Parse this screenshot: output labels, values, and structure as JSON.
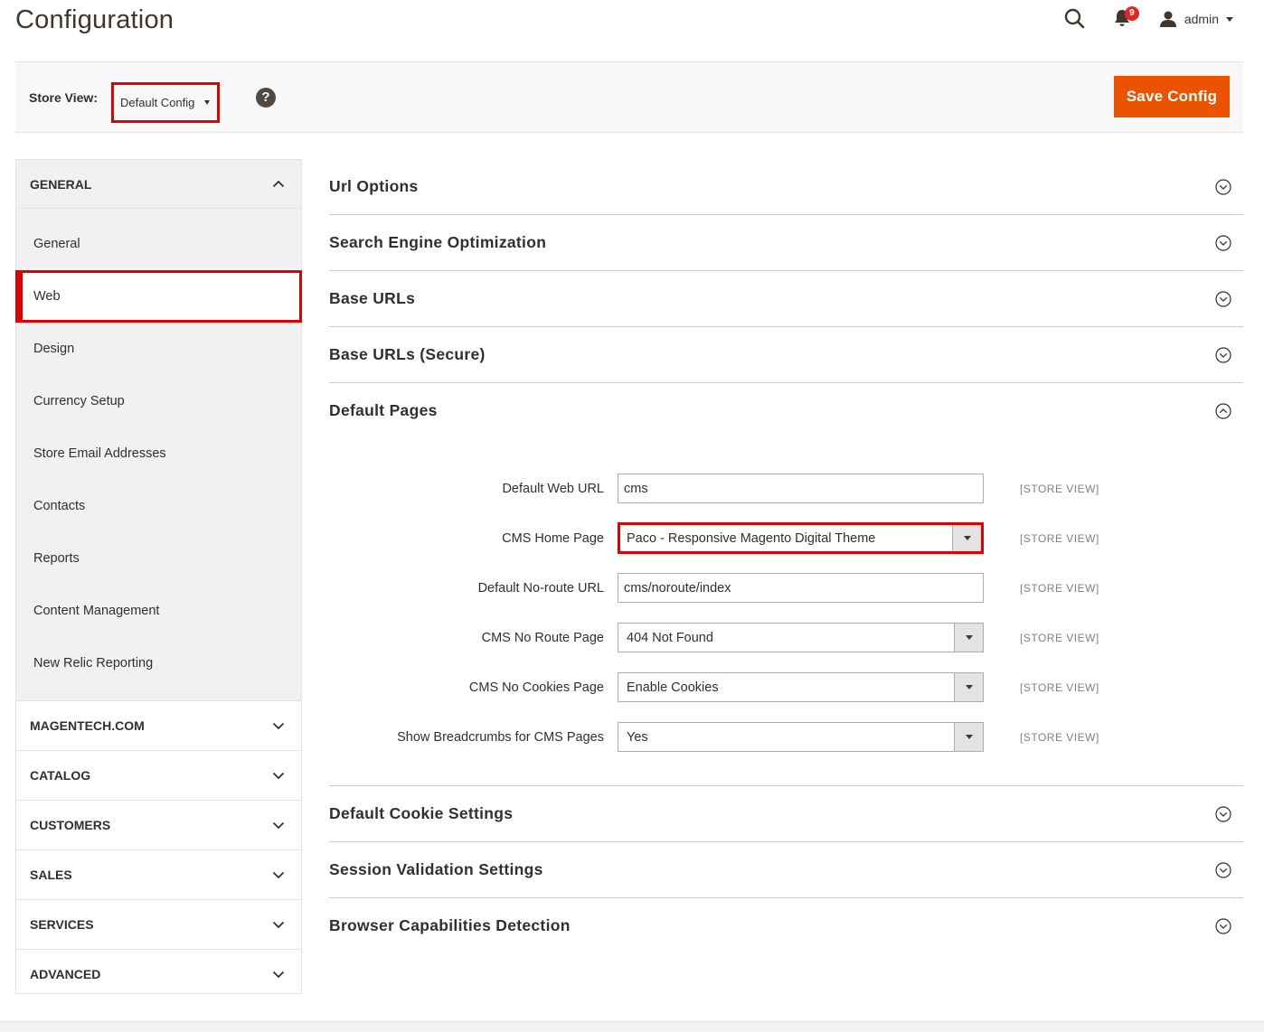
{
  "header": {
    "title": "Configuration",
    "notification_count": "9",
    "user_name": "admin",
    "icons": [
      "search-icon",
      "bell-icon",
      "user-icon"
    ]
  },
  "toolbar": {
    "store_view_label": "Store View:",
    "store_view_value": "Default Config",
    "help_glyph": "?",
    "save_label": "Save Config",
    "save_color": "#eb5202"
  },
  "sidebar": {
    "general": {
      "label": "GENERAL",
      "items": [
        {
          "label": "General"
        },
        {
          "label": "Web"
        },
        {
          "label": "Design"
        },
        {
          "label": "Currency Setup"
        },
        {
          "label": "Store Email Addresses"
        },
        {
          "label": "Contacts"
        },
        {
          "label": "Reports"
        },
        {
          "label": "Content Management"
        },
        {
          "label": "New Relic Reporting"
        }
      ]
    },
    "groups": [
      {
        "label": "MAGENTECH.COM"
      },
      {
        "label": "CATALOG"
      },
      {
        "label": "CUSTOMERS"
      },
      {
        "label": "SALES"
      },
      {
        "label": "SERVICES"
      },
      {
        "label": "ADVANCED"
      }
    ]
  },
  "main": {
    "sections": [
      {
        "title": "Url Options"
      },
      {
        "title": "Search Engine Optimization"
      },
      {
        "title": "Base URLs"
      },
      {
        "title": "Base URLs (Secure)"
      },
      {
        "title": "Default Pages"
      },
      {
        "title": "Default Cookie Settings"
      },
      {
        "title": "Session Validation Settings"
      },
      {
        "title": "Browser Capabilities Detection"
      }
    ],
    "default_pages": {
      "scope": "[STORE VIEW]",
      "fields": [
        {
          "label": "Default Web URL",
          "value": "cms"
        },
        {
          "label": "CMS Home Page",
          "value": "Paco - Responsive Magento Digital Theme"
        },
        {
          "label": "Default No-route URL",
          "value": "cms/noroute/index"
        },
        {
          "label": "CMS No Route Page",
          "value": "404 Not Found"
        },
        {
          "label": "CMS No Cookies Page",
          "value": "Enable Cookies"
        },
        {
          "label": "Show Breadcrumbs for CMS Pages",
          "value": "Yes"
        }
      ]
    }
  }
}
